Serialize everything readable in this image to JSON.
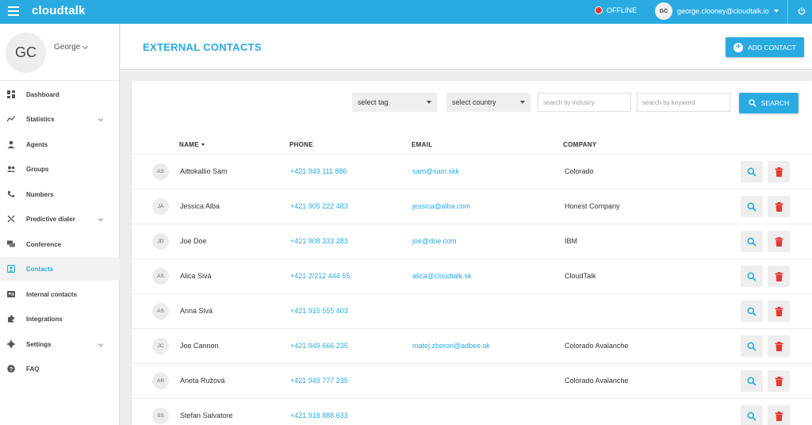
{
  "topbar": {
    "brand": "cloudtalk",
    "status": "OFFLINE",
    "user_initials": "GC",
    "user_email": "george.clooney@cloudtalk.io"
  },
  "sidebar": {
    "profile": {
      "initials": "GC",
      "name": "George"
    },
    "items": [
      {
        "label": "Dashboard",
        "icon": "dashboard-icon",
        "expandable": false,
        "active": false
      },
      {
        "label": "Statistics",
        "icon": "statistics-icon",
        "expandable": true,
        "active": false
      },
      {
        "label": "Agents",
        "icon": "agent-icon",
        "expandable": false,
        "active": false
      },
      {
        "label": "Groups",
        "icon": "groups-icon",
        "expandable": false,
        "active": false
      },
      {
        "label": "Numbers",
        "icon": "phone-icon",
        "expandable": false,
        "active": false
      },
      {
        "label": "Predictive dialer",
        "icon": "shuffle-icon",
        "expandable": true,
        "active": false
      },
      {
        "label": "Conference",
        "icon": "chat-icon",
        "expandable": false,
        "active": false
      },
      {
        "label": "Contacts",
        "icon": "contacts-icon",
        "expandable": false,
        "active": true
      },
      {
        "label": "Internal contacts",
        "icon": "contact-card-icon",
        "expandable": false,
        "active": false
      },
      {
        "label": "Integrations",
        "icon": "puzzle-icon",
        "expandable": false,
        "active": false
      },
      {
        "label": "Settings",
        "icon": "gear-icon",
        "expandable": true,
        "active": false
      },
      {
        "label": "FAQ",
        "icon": "help-icon",
        "expandable": false,
        "active": false
      }
    ]
  },
  "header": {
    "title": "EXTERNAL CONTACTS",
    "add_label": "ADD CONTACT"
  },
  "filters": {
    "tag": "select tag",
    "country": "select country",
    "industry_placeholder": "search by industry",
    "keyword_placeholder": "search by keyword",
    "search_label": "SEARCH"
  },
  "table": {
    "columns": {
      "name": "NAME",
      "phone": "PHONE",
      "email": "EMAIL",
      "company": "COMPANY"
    },
    "rows": [
      {
        "initials": "AS",
        "name": "Aittokallio Sam",
        "phone": "+421 949 111 886",
        "email": "sam@sam.skk",
        "company": "Colorado"
      },
      {
        "initials": "JA",
        "name": "Jessica Alba",
        "phone": "+421 905 222 483",
        "email": "jessica@alba.com",
        "company": "Honest Company"
      },
      {
        "initials": "JD",
        "name": "Joe Doe",
        "phone": "+421 908 333 283",
        "email": "joe@doe.com",
        "company": "IBM"
      },
      {
        "initials": "AS",
        "name": "Alica Sivá",
        "phone": "+421 2/212 444 55",
        "email": "alica@cloudtalk.sk",
        "company": "CloudTalk"
      },
      {
        "initials": "AS",
        "name": "Anna Sivá",
        "phone": "+421 915 555 403",
        "email": "",
        "company": ""
      },
      {
        "initials": "JC",
        "name": "Joe Cannon",
        "phone": "+421 949 666 235",
        "email": "matej.zboron@adbee.sk",
        "company": "Colorado Avalanche"
      },
      {
        "initials": "AR",
        "name": "Aneta Ružová",
        "phone": "+421 949 777 235",
        "email": "",
        "company": "Colorado Avalanche"
      },
      {
        "initials": "SS",
        "name": "Stefan Salvatore",
        "phone": "+421 918 888 633",
        "email": "",
        "company": ""
      }
    ]
  },
  "colors": {
    "accent": "#29abe2",
    "danger": "#e53935",
    "offline": "#e53935"
  }
}
